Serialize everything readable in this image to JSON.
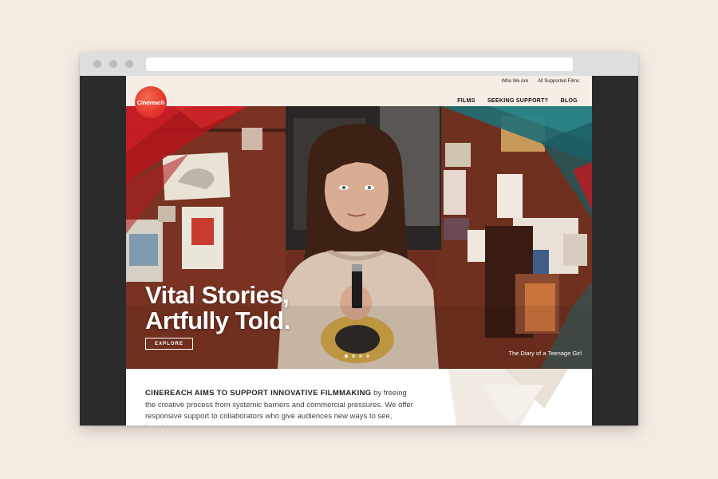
{
  "header": {
    "logo_text": "Cinereach",
    "utility_nav": [
      "Who We Are",
      "All Supported Films"
    ],
    "main_nav": [
      "FILMS",
      "SEEKING SUPPORT?",
      "BLOG"
    ]
  },
  "hero": {
    "title_line1": "Vital Stories,",
    "title_line2": "Artfully Told.",
    "cta_label": "EXPLORE",
    "caption": "The Diary of a Teenage Girl",
    "slide_count": 4,
    "active_slide": 1
  },
  "intro": {
    "lead": "CINEREACH AIMS TO SUPPORT INNOVATIVE FILMMAKING",
    "text": " by freeing the creative process from systemic barriers and commercial pressures. We offer responsive support to collaborators who give audiences new ways to see, imagine,"
  },
  "colors": {
    "brand_red": "#e63a2e",
    "page_bg": "#f4ebe2",
    "header_bg": "#f6ede4",
    "teal_accent": "#1f6f74"
  }
}
